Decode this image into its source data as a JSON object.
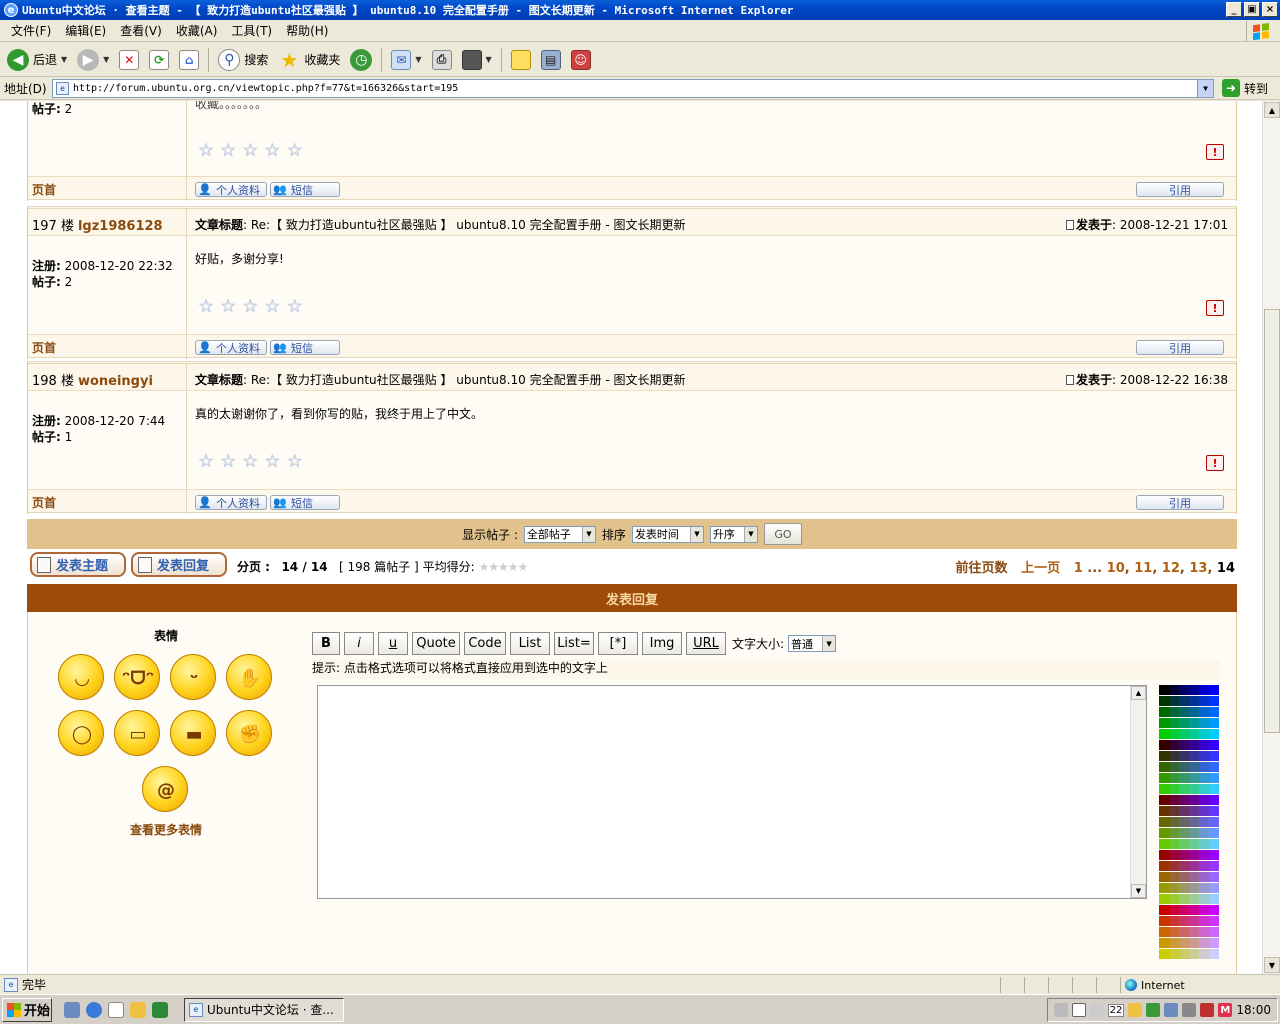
{
  "window": {
    "title": "Ubuntu中文论坛 · 查看主题 - 【 致力打造ubuntu社区最强贴 】 ubuntu8.10 完全配置手册 - 图文长期更新 - Microsoft Internet Explorer",
    "controls": [
      "_",
      "▣",
      "×"
    ]
  },
  "menu": [
    "文件(F)",
    "编辑(E)",
    "查看(V)",
    "收藏(A)",
    "工具(T)",
    "帮助(H)"
  ],
  "toolbar": {
    "back": "后退",
    "search": "搜索",
    "favorites": "收藏夹"
  },
  "address": {
    "label": "地址(D)",
    "url": "http://forum.ubuntu.org.cn/viewtopic.php?f=77&t=166326&start=195",
    "go": "转到"
  },
  "prev_post": {
    "partial_text": "收藏。。。。。。。",
    "posts_label": "帖子:",
    "posts": "2",
    "top": "页首",
    "profile": "个人资料",
    "pm": "短信",
    "quote": "引用"
  },
  "posts": [
    {
      "floor": "197 楼",
      "user": "lgz1986128",
      "subject_label": "文章标题",
      "subject": ": Re:【 致力打造ubuntu社区最强贴 】 ubuntu8.10 完全配置手册 - 图文长期更新",
      "posted_label": "发表于",
      "posted": ": 2008-12-21 17:01",
      "reg_label": "注册:",
      "reg": "2008-12-20 22:32",
      "posts_label": "帖子:",
      "posts": "2",
      "text": "好贴，多谢分享!",
      "top": "页首",
      "profile": "个人资料",
      "pm": "短信",
      "quote": "引用"
    },
    {
      "floor": "198 楼",
      "user": "woneingyi",
      "subject_label": "文章标题",
      "subject": ": Re:【 致力打造ubuntu社区最强贴 】 ubuntu8.10 完全配置手册 - 图文长期更新",
      "posted_label": "发表于",
      "posted": ": 2008-12-22 16:38",
      "reg_label": "注册:",
      "reg": "2008-12-20 7:44",
      "posts_label": "帖子:",
      "posts": "1",
      "text": "真的太谢谢你了，看到你写的贴，我终于用上了中文。",
      "top": "页首",
      "profile": "个人资料",
      "pm": "短信",
      "quote": "引用"
    }
  ],
  "sortbar": {
    "show_label": "显示帖子 :",
    "show_value": "全部帖子",
    "sort_label": "排序",
    "sort_value": "发表时间",
    "order_value": "升序",
    "go": "GO"
  },
  "pager": {
    "new_topic": "发表主题",
    "reply": "发表回复",
    "page_label": "分页 :",
    "page": "14 / 14",
    "count": "[ 198 篇帖子 ]",
    "rating_label": "平均得分:",
    "goto_label": "前往页数",
    "prev": "上一页",
    "p1": "1",
    "ellipsis": "...",
    "p10": "10",
    "p11": "11",
    "p12": "12",
    "p13": "13",
    "p14": "14"
  },
  "reply_panel": {
    "title": "发表回复",
    "emoticons_title": "表情",
    "more_emoticons": "查看更多表情",
    "format_buttons": [
      "B",
      "i",
      "u",
      "Quote",
      "Code",
      "List",
      "List=",
      "[*]",
      "Img",
      "URL"
    ],
    "font_size_label": "文字大小:",
    "font_size_value": "普通",
    "hint": "提示: 点击格式选项可以将格式直接应用到选中的文字上"
  },
  "statusbar": {
    "text": "完毕",
    "zone": "Internet"
  },
  "taskbar": {
    "start": "开始",
    "task": "Ubuntu中文论坛 · 查...",
    "date": "22",
    "clock": "18:00"
  }
}
